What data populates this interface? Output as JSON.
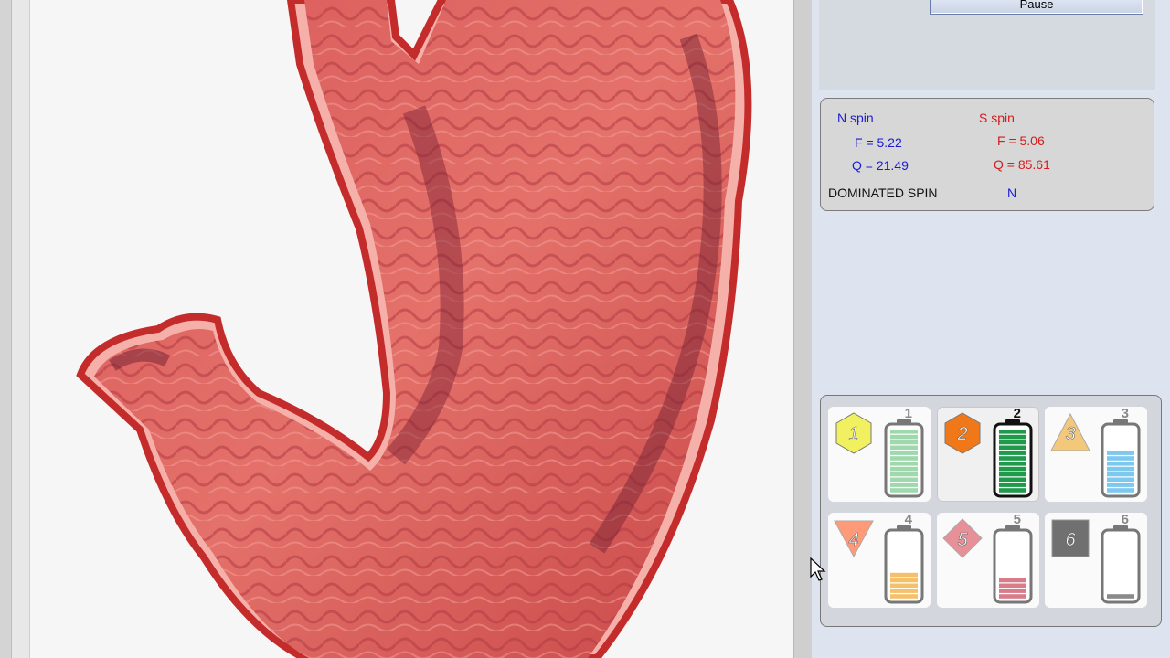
{
  "controls": {
    "pause_label": "Pause"
  },
  "spin": {
    "n_label": "N spin",
    "n_f": "F =  5.22",
    "n_q": "Q = 21.49",
    "s_label": "S spin",
    "s_f": "F =  5.06",
    "s_q": "Q = 85.61",
    "dominated_label": "DOMINATED SPIN",
    "dominated_value": "N"
  },
  "batteries": [
    {
      "num": "1",
      "badge": "hexagon",
      "badge_color": "#f0f060",
      "fill_color": "#9fd8ad",
      "level": 1.0,
      "selected": false
    },
    {
      "num": "2",
      "badge": "hexagon",
      "badge_color": "#f07818",
      "fill_color": "#1e9a4a",
      "level": 1.0,
      "selected": true
    },
    {
      "num": "3",
      "badge": "triangle-up",
      "badge_color": "#f4c87a",
      "fill_color": "#7cc8ee",
      "level": 0.7,
      "selected": false
    },
    {
      "num": "4",
      "badge": "triangle-down",
      "badge_color": "#ff9a78",
      "fill_color": "#f4c06a",
      "level": 0.45,
      "selected": false
    },
    {
      "num": "5",
      "badge": "diamond",
      "badge_color": "#e89098",
      "fill_color": "#d87c8a",
      "level": 0.3,
      "selected": false
    },
    {
      "num": "6",
      "badge": "square",
      "badge_color": "#707070",
      "fill_color": "#8a8a8a",
      "level": 0.1,
      "selected": false
    }
  ]
}
